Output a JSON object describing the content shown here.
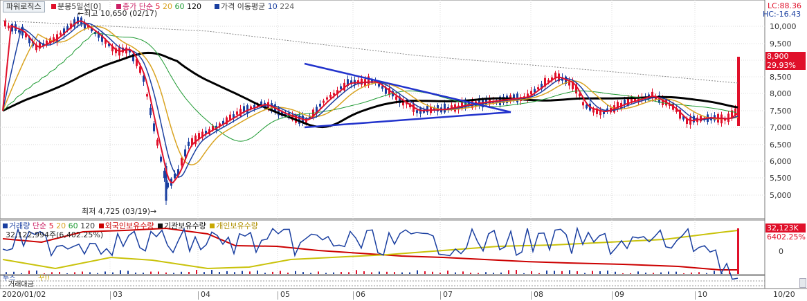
{
  "toolbar": {
    "powerlogix_button": "파워로직스",
    "candle_label": "분봉5일선[0]",
    "close_ma_label": "종가 단순",
    "ma_periods": [
      "5",
      "20",
      "60",
      "120"
    ],
    "ma_colors": [
      "#e0102a",
      "#d9a320",
      "#1e9a32",
      "#000000"
    ],
    "price_ma_label": "가격 이동평균",
    "price_ma_periods": [
      "10",
      "224"
    ]
  },
  "right_axis": {
    "lc": "LC:88.36",
    "hc": "HC:-16.43",
    "price_ticks": [
      "10,000",
      "9,500",
      "9,000",
      "8,500",
      "8,000",
      "7,500",
      "7,000",
      "6,500",
      "6,000",
      "5,500",
      "5,000"
    ],
    "price_tag": "8,900",
    "pct_tag": "29.93%",
    "vol_tag": "32,123K",
    "vol_pct_tag": "6402.25%",
    "vol_zero_tick": "0"
  },
  "annotations": {
    "high": "최고 10,650 (02/17)",
    "low": "최저 4,725 (03/19)"
  },
  "volume_panel": {
    "labels": [
      "거래량",
      "단순",
      "5",
      "20",
      "60",
      "120",
      "외국인보유수량",
      "기관보유수량",
      "개인보유수량"
    ],
    "colors": [
      "#1a3fa0",
      "#cc2266",
      "#e0102a",
      "#d9a320",
      "#1e9a32",
      "#333333",
      "#cc0000",
      "#111111",
      "#c9a800"
    ],
    "value_text": "32,122,994주(6,402.25%)"
  },
  "bottom_panels": {
    "row1": "누스",
    "row1b": "꾸!!",
    "row2": "거래대금"
  },
  "x_axis": {
    "ticks": [
      "2020/01/02",
      "03",
      "04",
      "05",
      "06",
      "07",
      "08",
      "09",
      "10"
    ],
    "last_date": "10/20"
  },
  "colors": {
    "candle_up": "#e0102a",
    "candle_down": "#1a3fa0",
    "ma5": "#e0102a",
    "ma10": "#1a3fa0",
    "ma20": "#d9a320",
    "ma60": "#1e9a32",
    "ma120": "#000000",
    "ma224": "#888888",
    "trendline": "#2233cc"
  }
}
